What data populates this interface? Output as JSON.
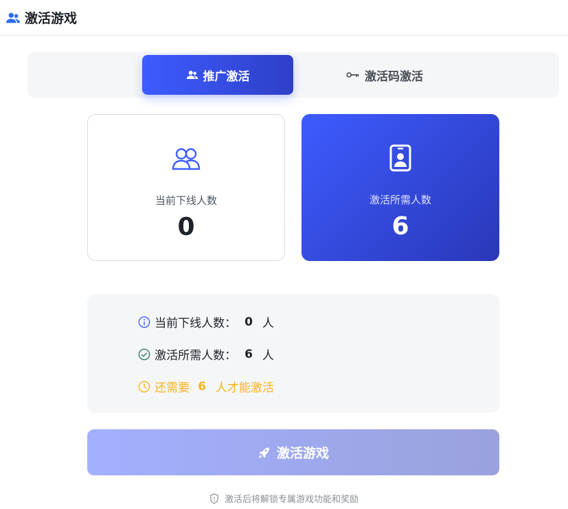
{
  "header": {
    "title": "激活游戏",
    "icon": "users-icon"
  },
  "tabs": [
    {
      "label": "推广激活",
      "icon": "users-icon",
      "active": true
    },
    {
      "label": "激活码激活",
      "icon": "key-icon",
      "active": false
    }
  ],
  "cards": {
    "current": {
      "label": "当前下线人数",
      "value": "0",
      "icon": "users-outline-icon"
    },
    "required": {
      "label": "激活所需人数",
      "value": "6",
      "icon": "id-badge-icon"
    }
  },
  "info": {
    "current": {
      "label": "当前下线人数：",
      "value": "0",
      "unit": "人",
      "icon": "info-circle-icon"
    },
    "required": {
      "label": "激活所需人数：",
      "value": "6",
      "unit": "人",
      "icon": "check-circle-icon"
    },
    "remaining": {
      "prefix": "还需要",
      "value": "6",
      "suffix": "人才能激活",
      "icon": "clock-icon"
    }
  },
  "activate_button": {
    "label": "激活游戏",
    "icon": "rocket-icon"
  },
  "footnote": {
    "text": "激活后将解锁专属游戏功能和奖励",
    "icon": "shield-icon"
  },
  "colors": {
    "primary": "#3d5cff",
    "warning": "#f5b51c",
    "success": "#2f7d5b"
  }
}
